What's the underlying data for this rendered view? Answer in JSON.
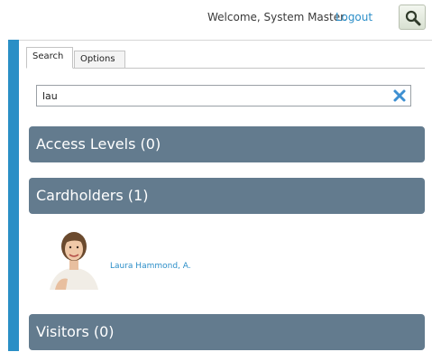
{
  "header": {
    "welcome_text": "Welcome, System Master.",
    "logout_label": "Logout",
    "search_icon": "magnifier-icon"
  },
  "tabs": [
    {
      "label": "Search",
      "active": true
    },
    {
      "label": "Options",
      "active": false
    }
  ],
  "search": {
    "value": "lau",
    "clear_icon": "clear-x-icon"
  },
  "sections": {
    "access_levels": "Access Levels (0)",
    "cardholders": "Cardholders (1)",
    "visitors": "Visitors (0)"
  },
  "cardholders": [
    {
      "name": "Laura Hammond, A."
    }
  ],
  "colors": {
    "accent": "#2a8fc6",
    "section_header": "#637b8e",
    "link": "#2b8ec8"
  }
}
